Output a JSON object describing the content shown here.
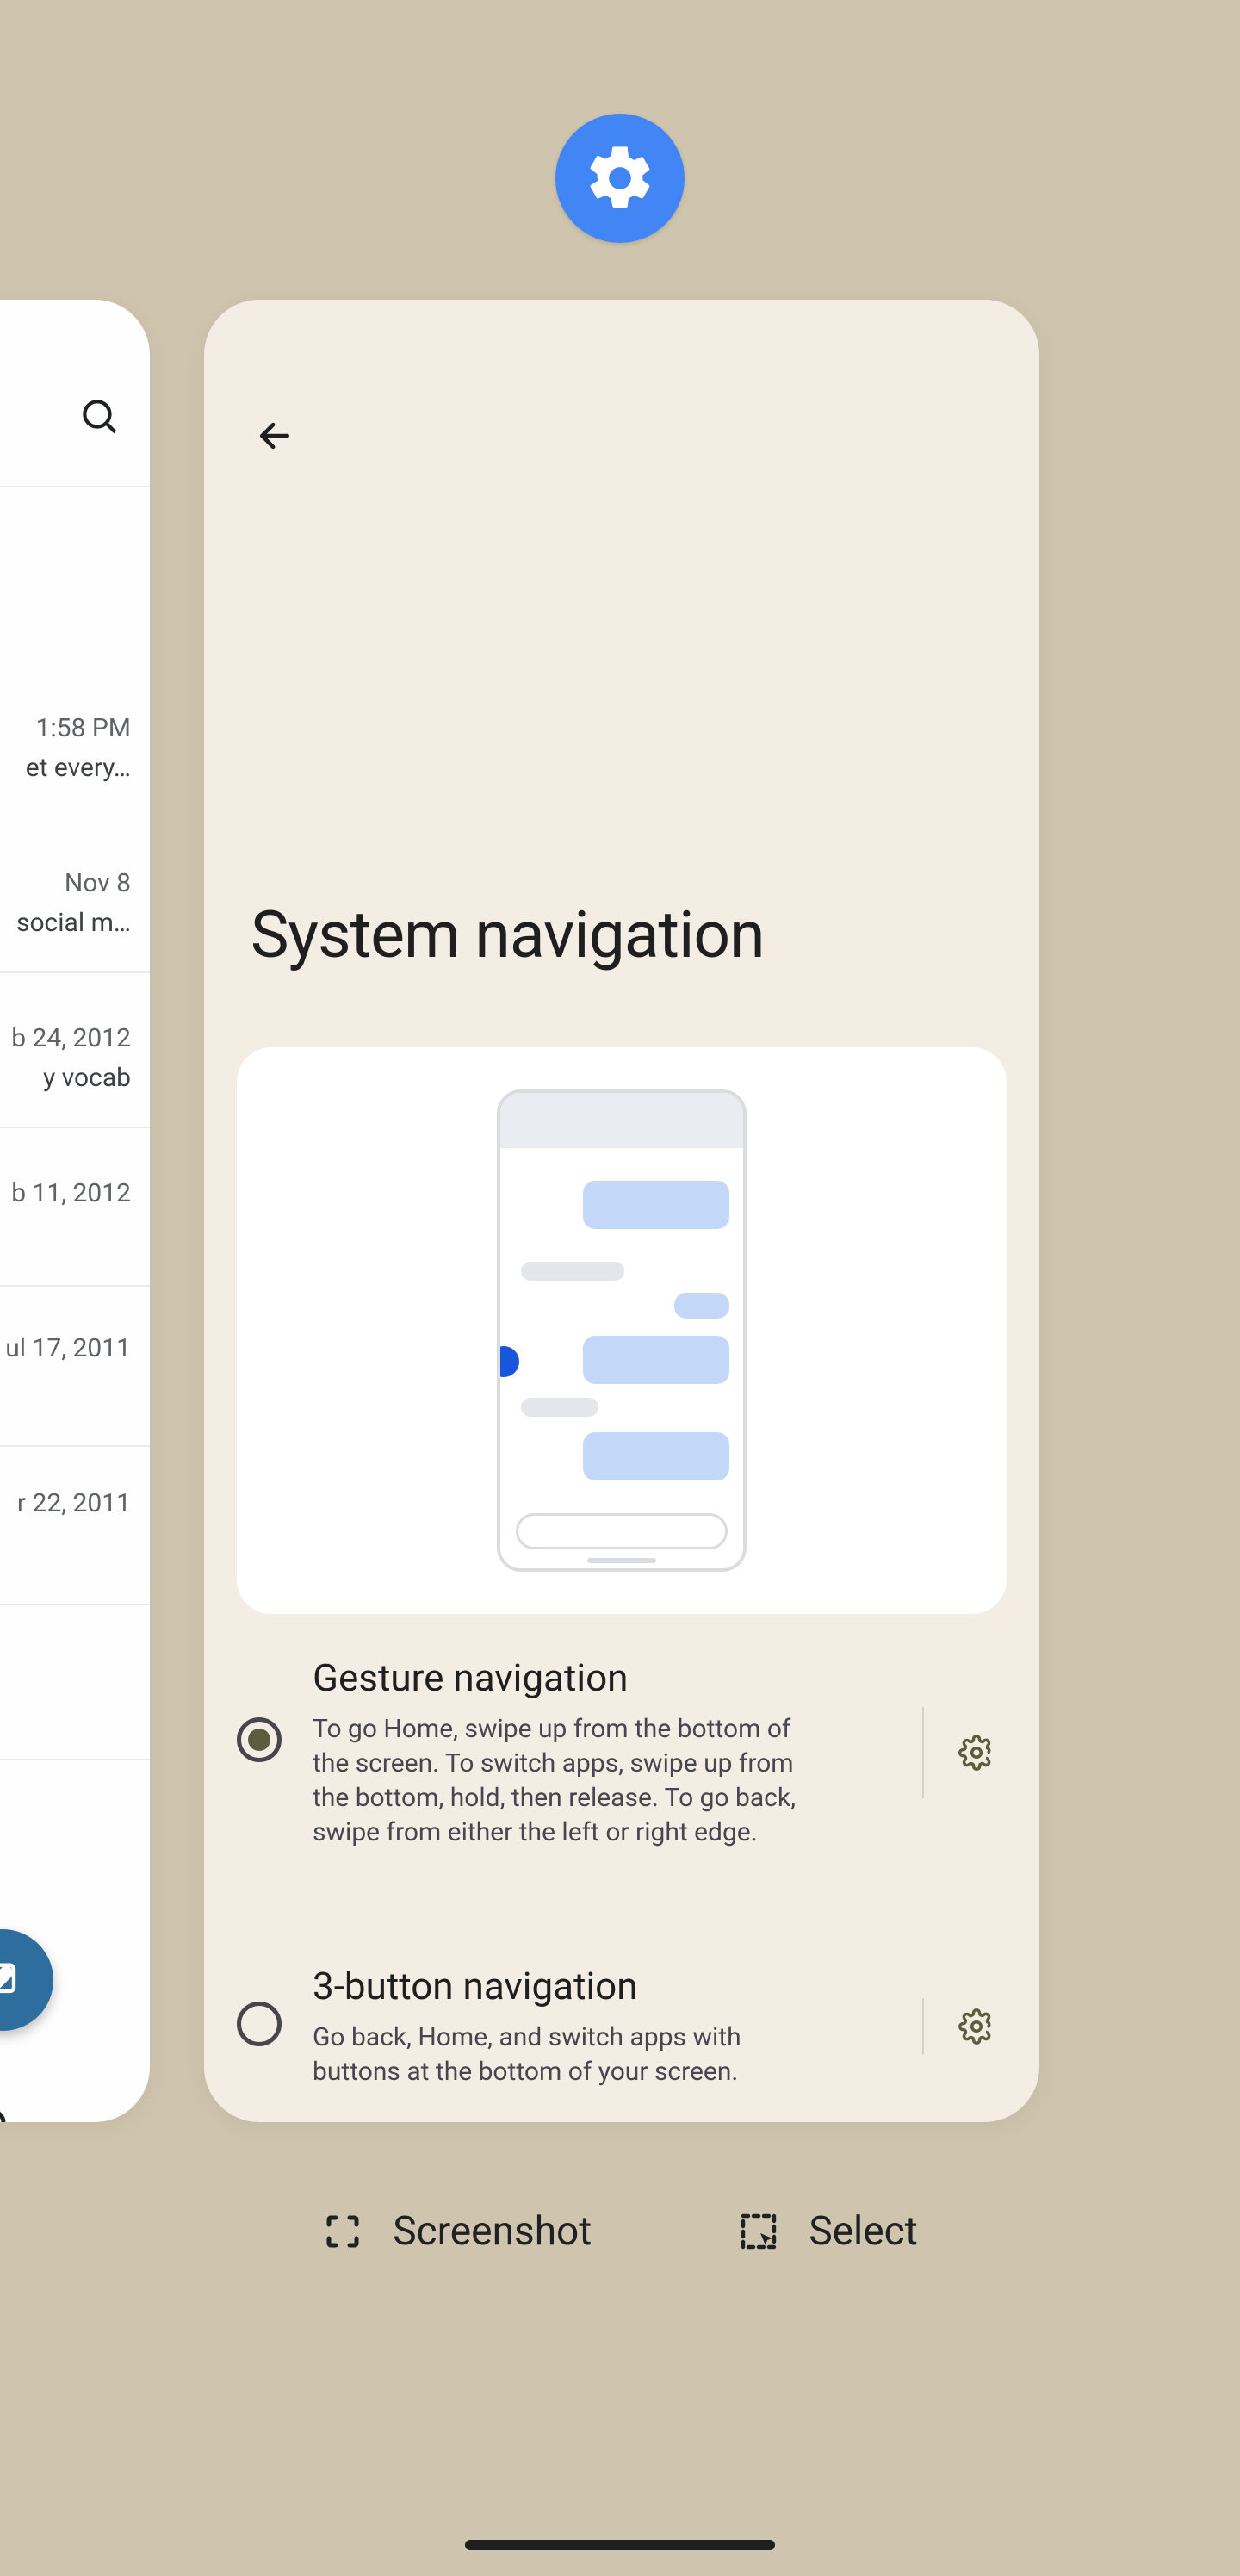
{
  "app_icon": "settings-icon",
  "settings_card": {
    "title": "System navigation",
    "options": [
      {
        "selected": true,
        "title": "Gesture navigation",
        "desc": "To go Home, swipe up from the bottom of the screen. To switch apps, swipe up from the bottom, hold, then release. To go back, swipe from either the left or right edge."
      },
      {
        "selected": false,
        "title": "3-button navigation",
        "desc": "Go back, Home, and switch apps with buttons at the bottom of your screen."
      }
    ]
  },
  "left_card": {
    "rows": [
      {
        "meta": "1:58 PM",
        "snippet": "et every…"
      },
      {
        "meta": "Nov 8",
        "snippet": "social m…"
      },
      {
        "meta": "b 24, 2012",
        "snippet": "y vocab"
      },
      {
        "meta": "b 11, 2012",
        "snippet": ""
      },
      {
        "meta": "ul 17, 2011",
        "snippet": ""
      },
      {
        "meta": "r 22, 2011",
        "snippet": ""
      }
    ]
  },
  "actions": {
    "screenshot": "Screenshot",
    "select": "Select"
  }
}
